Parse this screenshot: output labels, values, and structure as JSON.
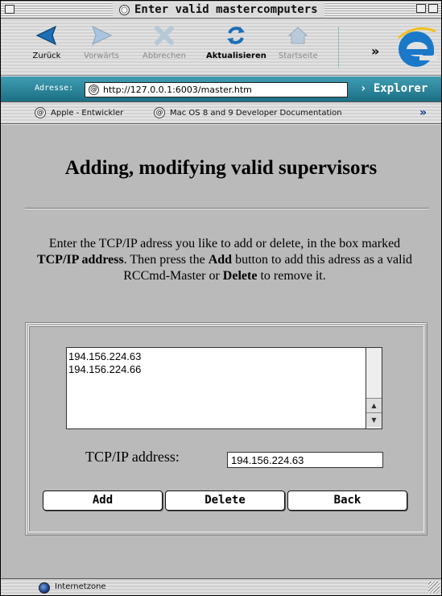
{
  "window": {
    "title": "Enter valid mastercomputers"
  },
  "toolbar": {
    "back": "Zurück",
    "forward": "Vorwärts",
    "stop": "Abbrechen",
    "refresh": "Aktualisieren",
    "home": "Startseite",
    "more": "»"
  },
  "address": {
    "label": "Adresse:",
    "url": "http://127.0.0.1:6003/master.htm",
    "explorer": "› Explorer"
  },
  "favorites": {
    "items": [
      "Apple - Entwickler",
      "Mac OS 8 and 9 Developer Documentation"
    ],
    "more": "»"
  },
  "page": {
    "title": "Adding, modifying valid supervisors",
    "instructions": [
      "Enter the TCP/IP adress you like to add or delete, in the box marked ",
      "TCP/IP address",
      ". Then press the ",
      "Add",
      " button to add this adress as a valid RCCmd-Master or ",
      "Delete",
      " to remove it."
    ],
    "list_items": [
      "194.156.224.63",
      "194.156.224.66"
    ],
    "tcp_label": "TCP/IP address:",
    "tcp_value": "194.156.224.63",
    "buttons": {
      "add": "Add",
      "delete": "Delete",
      "back": "Back"
    }
  },
  "status": {
    "zone": "Internetzone"
  },
  "colors": {
    "address_bar": "#2a8aa0",
    "content_bg": "#bababa",
    "ie_logo": "#1a78c8"
  }
}
